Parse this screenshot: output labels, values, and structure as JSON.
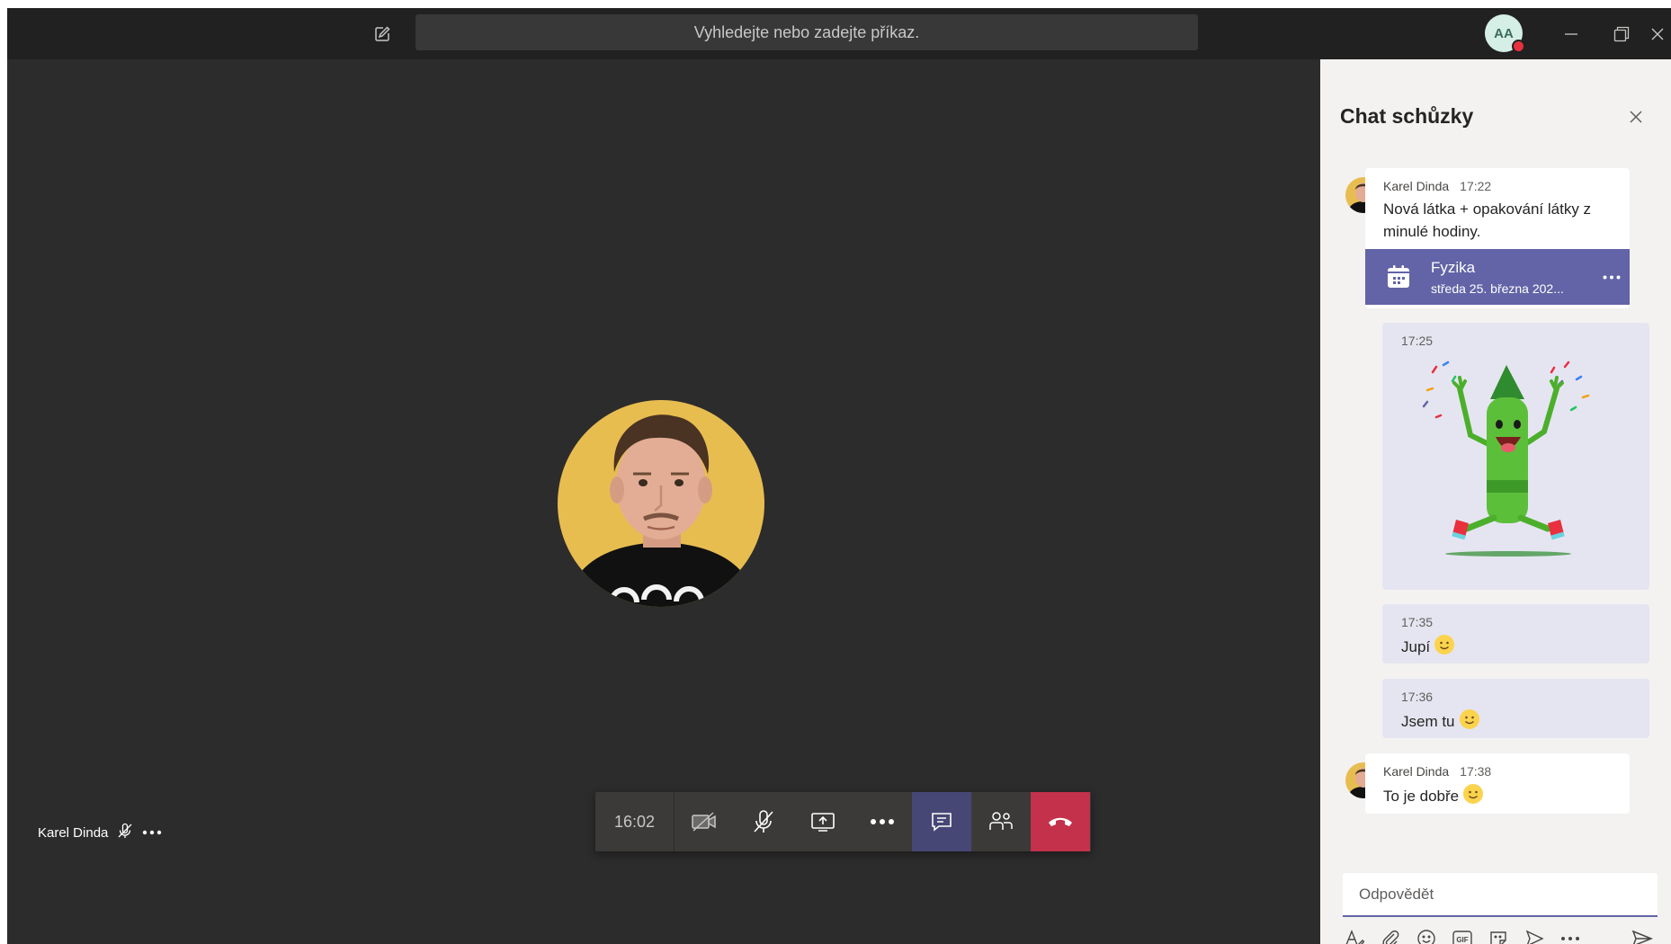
{
  "titlebar": {
    "search_placeholder": "Vyhledejte nebo zadejte příkaz.",
    "user_initials": "AA",
    "icons": [
      "compose-icon",
      "minimize-icon",
      "restore-icon",
      "close-icon"
    ]
  },
  "stage": {
    "participant_name": "Karel Dinda",
    "participant_muted": true
  },
  "controls": {
    "timer": "16:02",
    "buttons": [
      "camera-off-icon",
      "mic-off-icon",
      "share-screen-icon",
      "more-icon",
      "chat-icon",
      "participants-icon",
      "hang-up-icon"
    ]
  },
  "chat": {
    "title": "Chat schůzky",
    "messages": [
      {
        "author": "Karel Dinda",
        "time": "17:22",
        "text": "Nová látka + opakování látky z minulé hodiny.",
        "card": {
          "title": "Fyzika",
          "subtitle": "středa 25. března 202..."
        }
      },
      {
        "time": "17:25",
        "sticker": "dancing-crayon-sticker"
      },
      {
        "time": "17:35",
        "text": "Jupí",
        "emoji": "smile-emoji"
      },
      {
        "time": "17:36",
        "text": "Jsem tu",
        "emoji": "smile-emoji"
      },
      {
        "author": "Karel Dinda",
        "time": "17:38",
        "text": "To je dobře",
        "emoji": "smile-emoji"
      }
    ],
    "compose_placeholder": "Odpovědět",
    "tools": [
      "format-icon",
      "attach-icon",
      "emoji-icon",
      "gif-icon",
      "sticker-icon",
      "schedule-meeting-icon",
      "more-options-icon",
      "send-icon"
    ]
  },
  "colors": {
    "accent": "#6264a7",
    "hangup": "#c4314b",
    "stage_bg": "#2d2c2c",
    "titlebar_bg": "#212121",
    "presence_busy": "#e8303f",
    "presence_away": "#fdb913"
  }
}
